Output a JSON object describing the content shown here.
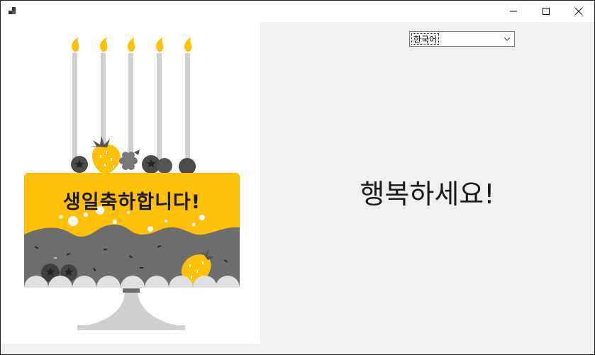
{
  "window": {
    "title": "",
    "app_icon": "app-icon",
    "controls": {
      "minimize": "minimize-icon",
      "maximize": "maximize-icon",
      "close": "close-icon"
    }
  },
  "cake": {
    "banner_text": "생일축하합니다!",
    "colors": {
      "frosting": "#FFC107",
      "cake_body": "#6D6D6D",
      "candle": "#CFCFCF",
      "flame": "#FFC107",
      "stand": "#CFCFCF"
    }
  },
  "language_select": {
    "selected": "한국어"
  },
  "greeting_text": "행복하세요!"
}
